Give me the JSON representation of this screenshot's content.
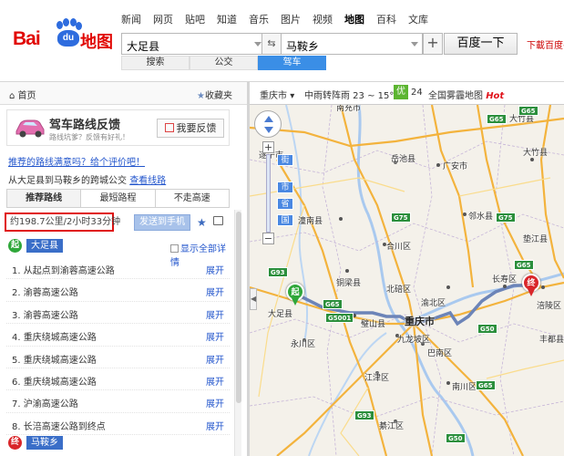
{
  "logo": {
    "bai": "Bai",
    "du": "du",
    "map": "地图"
  },
  "topnav": [
    "新闻",
    "网页",
    "贴吧",
    "知道",
    "音乐",
    "图片",
    "视频",
    "地图",
    "百科",
    "文库"
  ],
  "search": {
    "from": "大足县",
    "to": "马鞍乡",
    "button": "百度一下",
    "download": "下載百度手"
  },
  "modes": [
    "搜索",
    "公交",
    "驾车"
  ],
  "leftbar": {
    "home": "首页",
    "fav": "收藏夹"
  },
  "feedback": {
    "title": "驾车路线反馈",
    "subtitle": "路线坑爹？反馈有好礼！",
    "button": "我要反馈"
  },
  "satisfaction_link": "推荐的路线满意吗？给个评价吧！",
  "info": {
    "text": "从大足县到马鞍乡的跨城公交",
    "link": "查看线路"
  },
  "route_tabs": [
    "推荐路线",
    "最短路程",
    "不走高速"
  ],
  "summary": {
    "distance": "约198.7公里/2小时33分钟",
    "send": "发送到手机"
  },
  "start": {
    "icon": "起",
    "city": "大足县",
    "show_all": "显示全部详情"
  },
  "routes": [
    {
      "text": "1.  从起点到渝蓉高速公路",
      "expand": "展开"
    },
    {
      "text": "2.  渝蓉高速公路",
      "expand": "展开"
    },
    {
      "text": "3.  渝蓉高速公路",
      "expand": "展开"
    },
    {
      "text": "4.  重庆绕城高速公路",
      "expand": "展开"
    },
    {
      "text": "5.  重庆绕城高速公路",
      "expand": "展开"
    },
    {
      "text": "6.  重庆绕城高速公路",
      "expand": "展开"
    },
    {
      "text": "7.  沪渝高速公路",
      "expand": "展开"
    },
    {
      "text": "8.  长涪高速公路到终点",
      "expand": "展开"
    }
  ],
  "end": {
    "icon": "终",
    "city": "马鞍乡"
  },
  "maptop": {
    "city": "重庆市",
    "weather": "中雨转阵雨 23 ~ 15℃",
    "aqi_icon": "优",
    "aqi": "24",
    "fog": "全国雾霾地图",
    "hot": "Hot"
  },
  "map": {
    "zoom_labels": [
      "街",
      "市",
      "省",
      "国"
    ],
    "labels": [
      {
        "t": "南充市",
        "cls": "ml"
      },
      {
        "t": "大竹县",
        "cls": "ml"
      },
      {
        "t": "遂宁市",
        "cls": "ml"
      },
      {
        "t": "岳池县",
        "cls": "ml"
      },
      {
        "t": "广安市",
        "cls": "ml"
      },
      {
        "t": "邻水县",
        "cls": "ml"
      },
      {
        "t": "潼南县",
        "cls": "ml"
      },
      {
        "t": "合川区",
        "cls": "ml"
      },
      {
        "t": "垫江县",
        "cls": "ml"
      },
      {
        "t": "铜梁县",
        "cls": "ml"
      },
      {
        "t": "北碚区",
        "cls": "ml"
      },
      {
        "t": "长寿区",
        "cls": "ml"
      },
      {
        "t": "渝北区",
        "cls": "ml"
      },
      {
        "t": "涪陵区",
        "cls": "ml"
      },
      {
        "t": "重庆市",
        "cls": "ml big"
      },
      {
        "t": "璧山县",
        "cls": "ml"
      },
      {
        "t": "永川区",
        "cls": "ml"
      },
      {
        "t": "九龙坡区",
        "cls": "ml"
      },
      {
        "t": "巴南区",
        "cls": "ml"
      },
      {
        "t": "江津区",
        "cls": "ml"
      },
      {
        "t": "南川区",
        "cls": "ml"
      },
      {
        "t": "綦江区",
        "cls": "ml"
      },
      {
        "t": "大竹县",
        "cls": "ml"
      },
      {
        "t": "大足县",
        "cls": "ml"
      },
      {
        "t": "丰都县",
        "cls": "ml"
      }
    ],
    "shields": [
      {
        "t": "G65",
        "cls": "shield"
      },
      {
        "t": "G75",
        "cls": "shield"
      },
      {
        "t": "G65",
        "cls": "shield"
      },
      {
        "t": "G93",
        "cls": "shield"
      },
      {
        "t": "G5001",
        "cls": "shield"
      },
      {
        "t": "G65",
        "cls": "shield"
      },
      {
        "t": "G50",
        "cls": "shield"
      },
      {
        "t": "G65",
        "cls": "shield"
      },
      {
        "t": "G93",
        "cls": "shield"
      },
      {
        "t": "G65",
        "cls": "shield"
      },
      {
        "t": "G75",
        "cls": "shield"
      },
      {
        "t": "G50",
        "cls": "shield"
      }
    ]
  }
}
